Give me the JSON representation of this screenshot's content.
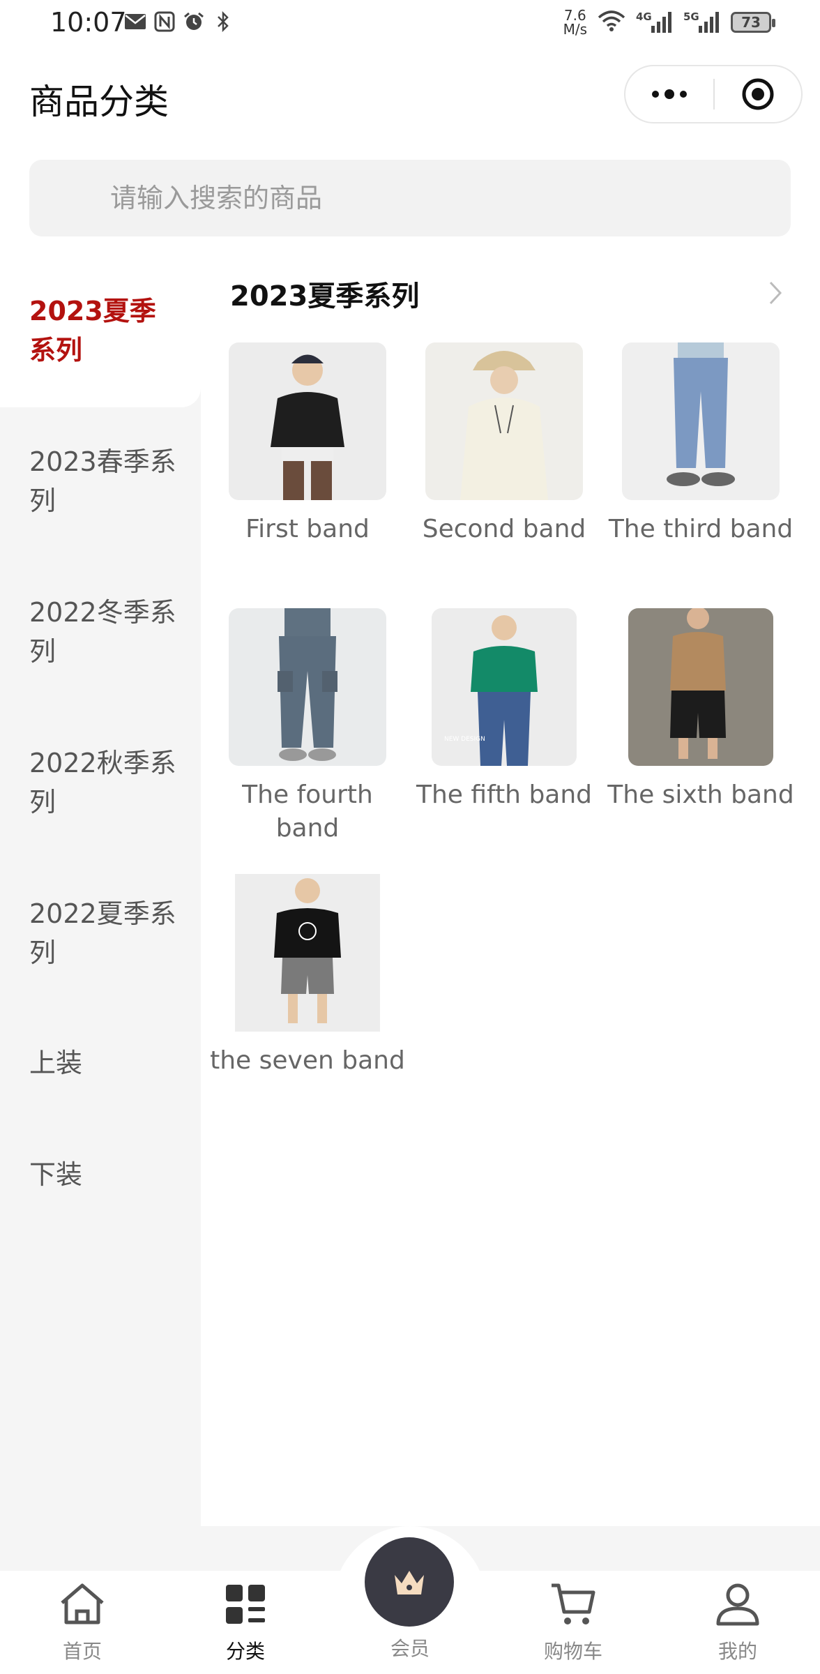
{
  "status_bar": {
    "time": "10:07",
    "net_speed_value": "7.6",
    "net_speed_unit": "M/s",
    "network_4g": "4G",
    "network_5g": "5G",
    "battery": "73"
  },
  "header": {
    "title": "商品分类",
    "more_icon": "more-dots-icon",
    "close_icon": "target-close-icon"
  },
  "search": {
    "placeholder": "请输入搜索的商品",
    "value": ""
  },
  "sidebar": {
    "items": [
      {
        "label": "2023夏季系列",
        "active": true
      },
      {
        "label": "2023春季系列",
        "active": false
      },
      {
        "label": "2022冬季系列",
        "active": false
      },
      {
        "label": "2022秋季系列",
        "active": false
      },
      {
        "label": "2022夏季系列",
        "active": false
      },
      {
        "label": "上装",
        "active": false
      },
      {
        "label": "下装",
        "active": false
      }
    ]
  },
  "content": {
    "section_title": "2023夏季系列",
    "items": [
      {
        "label": "First band"
      },
      {
        "label": "Second band"
      },
      {
        "label": "The third band"
      },
      {
        "label": "The fourth band"
      },
      {
        "label": "The fifth band"
      },
      {
        "label": "The sixth band"
      },
      {
        "label": "the seven band"
      }
    ]
  },
  "bottom_nav": {
    "items": [
      {
        "label": "首页",
        "icon": "home-icon",
        "active": false
      },
      {
        "label": "分类",
        "icon": "category-icon",
        "active": true
      },
      {
        "label": "会员",
        "icon": "crown-icon",
        "active": false
      },
      {
        "label": "购物车",
        "icon": "cart-icon",
        "active": false
      },
      {
        "label": "我的",
        "icon": "profile-icon",
        "active": false
      }
    ]
  },
  "colors": {
    "accent": "#b3120f",
    "sidebar_bg": "#f5f5f5",
    "member_button": "#3a3a44"
  }
}
